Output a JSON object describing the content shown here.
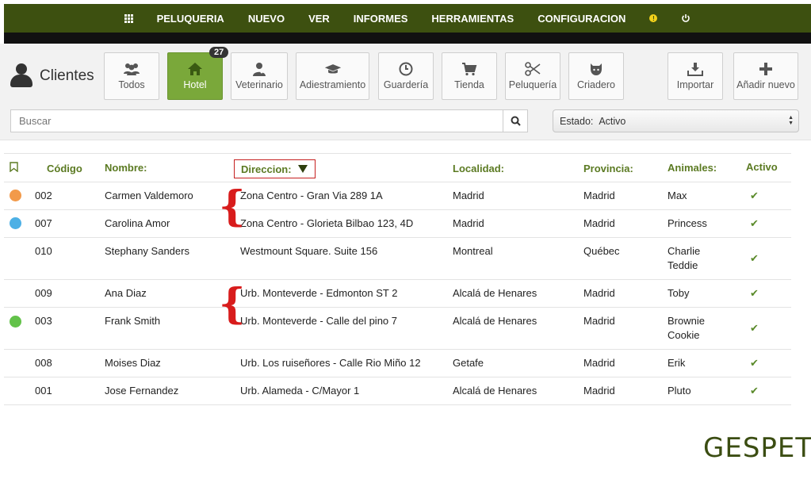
{
  "nav": {
    "items": [
      "PELUQUERIA",
      "NUEVO",
      "VER",
      "INFORMES",
      "HERRAMIENTAS",
      "CONFIGURACION"
    ],
    "icons": [
      "grid-icon",
      "warning-icon",
      "power-icon"
    ]
  },
  "page": {
    "title": "Clientes"
  },
  "toolbar": {
    "buttons": [
      {
        "label": "Todos",
        "icon": "users-icon"
      },
      {
        "label": "Hotel",
        "icon": "home-icon",
        "badge": "27",
        "active": true
      },
      {
        "label": "Veterinario",
        "icon": "doctor-icon"
      },
      {
        "label": "Adiestramiento",
        "icon": "graduation-cap-icon"
      },
      {
        "label": "Guardería",
        "icon": "clock-icon"
      },
      {
        "label": "Tienda",
        "icon": "cart-icon"
      },
      {
        "label": "Peluquería",
        "icon": "scissors-icon"
      },
      {
        "label": "Criadero",
        "icon": "github-cat-icon"
      },
      {
        "label": "Importar",
        "icon": "download-icon"
      },
      {
        "label": "Añadir nuevo",
        "icon": "plus-icon"
      }
    ]
  },
  "search": {
    "placeholder": "Buscar",
    "value": ""
  },
  "filter": {
    "label": "Estado:",
    "value": "Activo"
  },
  "table": {
    "headers": {
      "codigo": "Código",
      "nombre": "Nombre:",
      "direccion": "Direccion:",
      "localidad": "Localidad:",
      "provincia": "Provincia:",
      "animales": "Animales:",
      "activo": "Activo"
    },
    "rows": [
      {
        "dot": "#f29a4a",
        "code": "002",
        "name": "Carmen Valdemoro",
        "dir": "Zona Centro - Gran Via 289 1A",
        "loc": "Madrid",
        "prov": "Madrid",
        "animals": [
          "Max"
        ]
      },
      {
        "dot": "#4cb0e5",
        "code": "007",
        "name": "Carolina Amor",
        "dir": "Zona Centro - Glorieta Bilbao 123, 4D",
        "loc": "Madrid",
        "prov": "Madrid",
        "animals": [
          "Princess"
        ]
      },
      {
        "dot": "",
        "code": "010",
        "name": "Stephany Sanders",
        "dir": "Westmount Square. Suite 156",
        "loc": "Montreal",
        "prov": "Québec",
        "animals": [
          "Charlie",
          "Teddie"
        ]
      },
      {
        "dot": "",
        "code": "009",
        "name": "Ana Diaz",
        "dir": "Urb. Monteverde - Edmonton ST 2",
        "loc": "Alcalá de Henares",
        "prov": "Madrid",
        "animals": [
          "Toby"
        ]
      },
      {
        "dot": "#63c24a",
        "code": "003",
        "name": "Frank Smith",
        "dir": "Urb. Monteverde - Calle del pino 7",
        "loc": "Alcalá de Henares",
        "prov": "Madrid",
        "animals": [
          "Brownie",
          "Cookie"
        ]
      },
      {
        "dot": "",
        "code": "008",
        "name": "Moises Diaz",
        "dir": "Urb. Los ruiseñores - Calle Rio Miño 12",
        "loc": "Getafe",
        "prov": "Madrid",
        "animals": [
          "Erik"
        ]
      },
      {
        "dot": "",
        "code": "001",
        "name": "Jose Fernandez",
        "dir": "Urb. Alameda - C/Mayor 1",
        "loc": "Alcalá de Henares",
        "prov": "Madrid",
        "animals": [
          "Pluto"
        ]
      }
    ]
  },
  "brand": {
    "logo": "GESPET"
  },
  "colors": {
    "nav": "#3d5010",
    "accent": "#7aa83a",
    "header_text": "#5b7a22",
    "annotation": "#d81c1c"
  }
}
